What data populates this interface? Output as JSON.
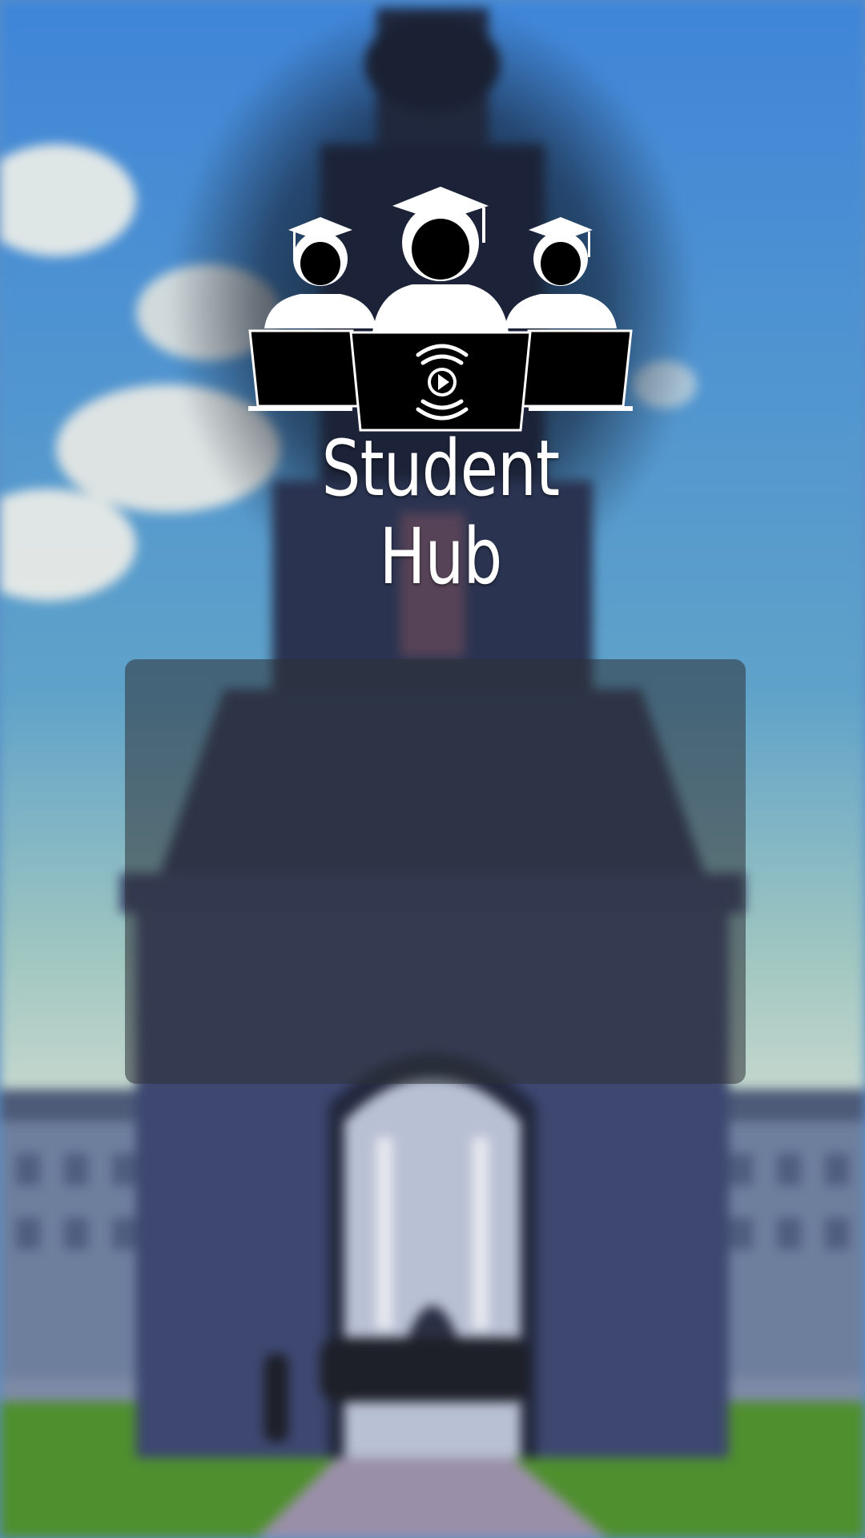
{
  "app": {
    "title": "Student Hub"
  },
  "logo": {
    "icon": "students-with-laptops-icon",
    "inner_icon": "play-broadcast-icon",
    "color": "#ffffff"
  },
  "background": {
    "description_icon": "campus-bell-tower-photo",
    "sky_color": "#4d8fd6",
    "grass_color": "#4f8f2e"
  },
  "panel": {
    "color": "#2d3237"
  }
}
